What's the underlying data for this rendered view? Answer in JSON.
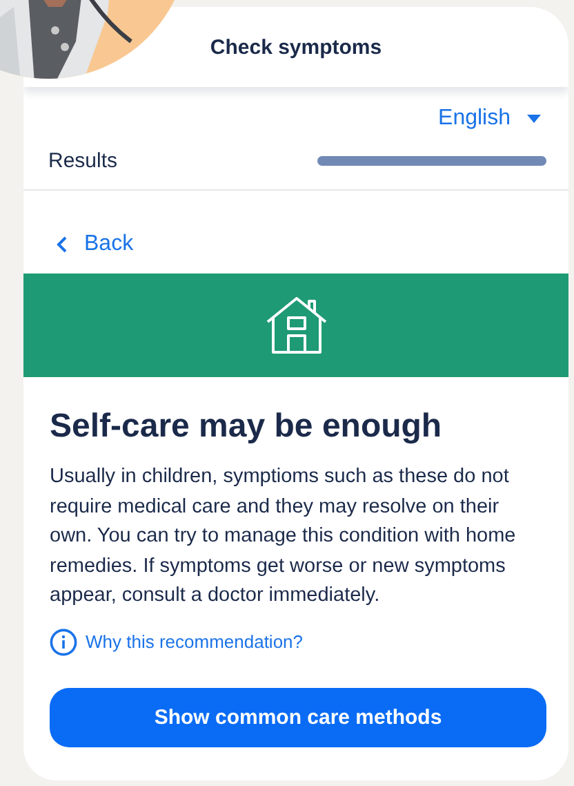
{
  "header": {
    "title": "Check symptoms"
  },
  "language": {
    "label": "English"
  },
  "progress": {
    "label": "Results",
    "level": 1
  },
  "back": {
    "label": "Back"
  },
  "result": {
    "title": "Self-care may be enough",
    "text": "Usually in children, symptioms such as these do not require medical care and they may resolve on their own. You can try to manage this condition with home remedies. If symptoms get worse or new symptoms appear, consult a doctor immediately.",
    "info_link": "Why this recommendation?",
    "button": "Show common care methods"
  }
}
